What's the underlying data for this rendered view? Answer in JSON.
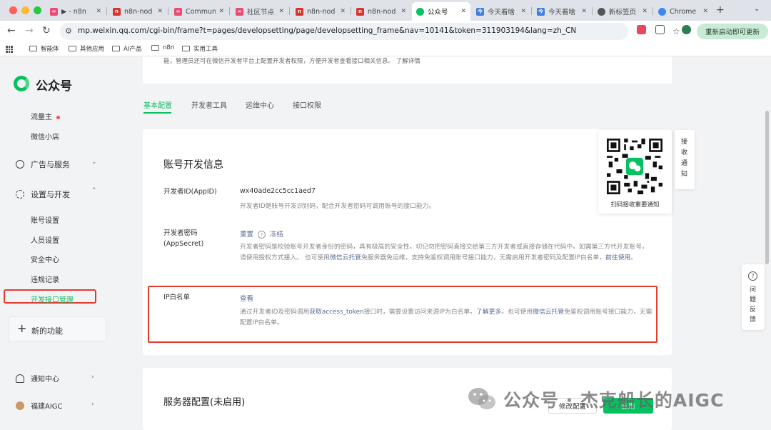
{
  "browser": {
    "tabs": [
      {
        "title": "▶ - n8n",
        "color": "#ea4b71"
      },
      {
        "title": "n8n-nod",
        "color": "#d9332b"
      },
      {
        "title": "Commun",
        "color": "#ea4b71"
      },
      {
        "title": "社区节点",
        "color": "#ea4b71"
      },
      {
        "title": "n8n-nod",
        "color": "#d9332b"
      },
      {
        "title": "n8n-nod",
        "color": "#d9332b"
      },
      {
        "title": "公众号",
        "color": "#07c160"
      },
      {
        "title": "今天看啥",
        "color": "#3c7de0"
      },
      {
        "title": "今天看啥",
        "color": "#3c7de0"
      },
      {
        "title": "新标签页",
        "color": "#555555"
      },
      {
        "title": "Chrome",
        "color": "#4285f4"
      }
    ],
    "url": "mp.weixin.qq.com/cgi-bin/frame?t=pages/developsetting/page/developsetting_frame&nav=10141&token=311903194&lang=zh_CN",
    "relaunch_label": "重新启动即可更新",
    "bookmarks": [
      "智能体",
      "其他应用",
      "AI产品",
      "n8n",
      "实用工具"
    ]
  },
  "sidebar": {
    "brand": "公众号",
    "items_top": [
      "流量主",
      "微信小店"
    ],
    "group_ads": "广告与服务",
    "group_settings": "设置与开发",
    "sub_items": [
      "账号设置",
      "人员设置",
      "安全中心",
      "违规记录"
    ],
    "active_item": "开发接口管理",
    "new_function": "新的功能",
    "notify": "通知中心",
    "account": "福建AIGC"
  },
  "main": {
    "top_note": "能，管理员还可在微信开发者平台上配置开发者权限，方便开发者查看接口相关信息。 了解详情",
    "tabs": [
      "基本配置",
      "开发者工具",
      "运维中心",
      "接口权限"
    ],
    "card_title": "账号开发信息",
    "appid_label": "开发者ID(AppID)",
    "appid_value": "wx40ade2cc5cc1aed7",
    "appid_desc": "开发者ID是账号开发识别码，配合开发者密码可调用账号的接口能力。",
    "secret_label": "开发者密码(AppSecret)",
    "secret_reset": "重置",
    "secret_freeze": "冻结",
    "secret_desc_1": "开发者密码是校验账号开发者身份的密码，具有极高的安全性。切记勿把密码直接交给第三方开发者或直接存储在代码中。如需第三方代开发账号，请使用授权方式接入。 也可使用",
    "secret_desc_link1": "微信云托管",
    "secret_desc_2": "免服务器免运维，支持免鉴权调用账号接口能力，无需启用开发者密码及配置IP白名单，",
    "secret_desc_link2": "前往使用",
    "secret_desc_3": "。",
    "ip_label": "IP白名单",
    "ip_view": "查看",
    "ip_desc_1": "通过开发者ID及密码调用",
    "ip_desc_link1": "获取access_token",
    "ip_desc_2": "接口时，需要设置访问来源IP为白名单。",
    "ip_desc_link2": "了解更多",
    "ip_desc_3": "。也可使用",
    "ip_desc_link3": "微信云托管",
    "ip_desc_4": "免鉴权调用账号接口能力，无需配置IP白名单。",
    "server_title": "服务器配置(未启用)",
    "modify_btn": "修改配置",
    "enable_btn": "启用"
  },
  "qr_popup": {
    "caption": "扫码接收重要通知",
    "side_tab": "接收通知"
  },
  "feedback": {
    "icon": "?",
    "label": "问题反馈"
  },
  "watermark": "公众号 · 杰克船长的AIGC"
}
